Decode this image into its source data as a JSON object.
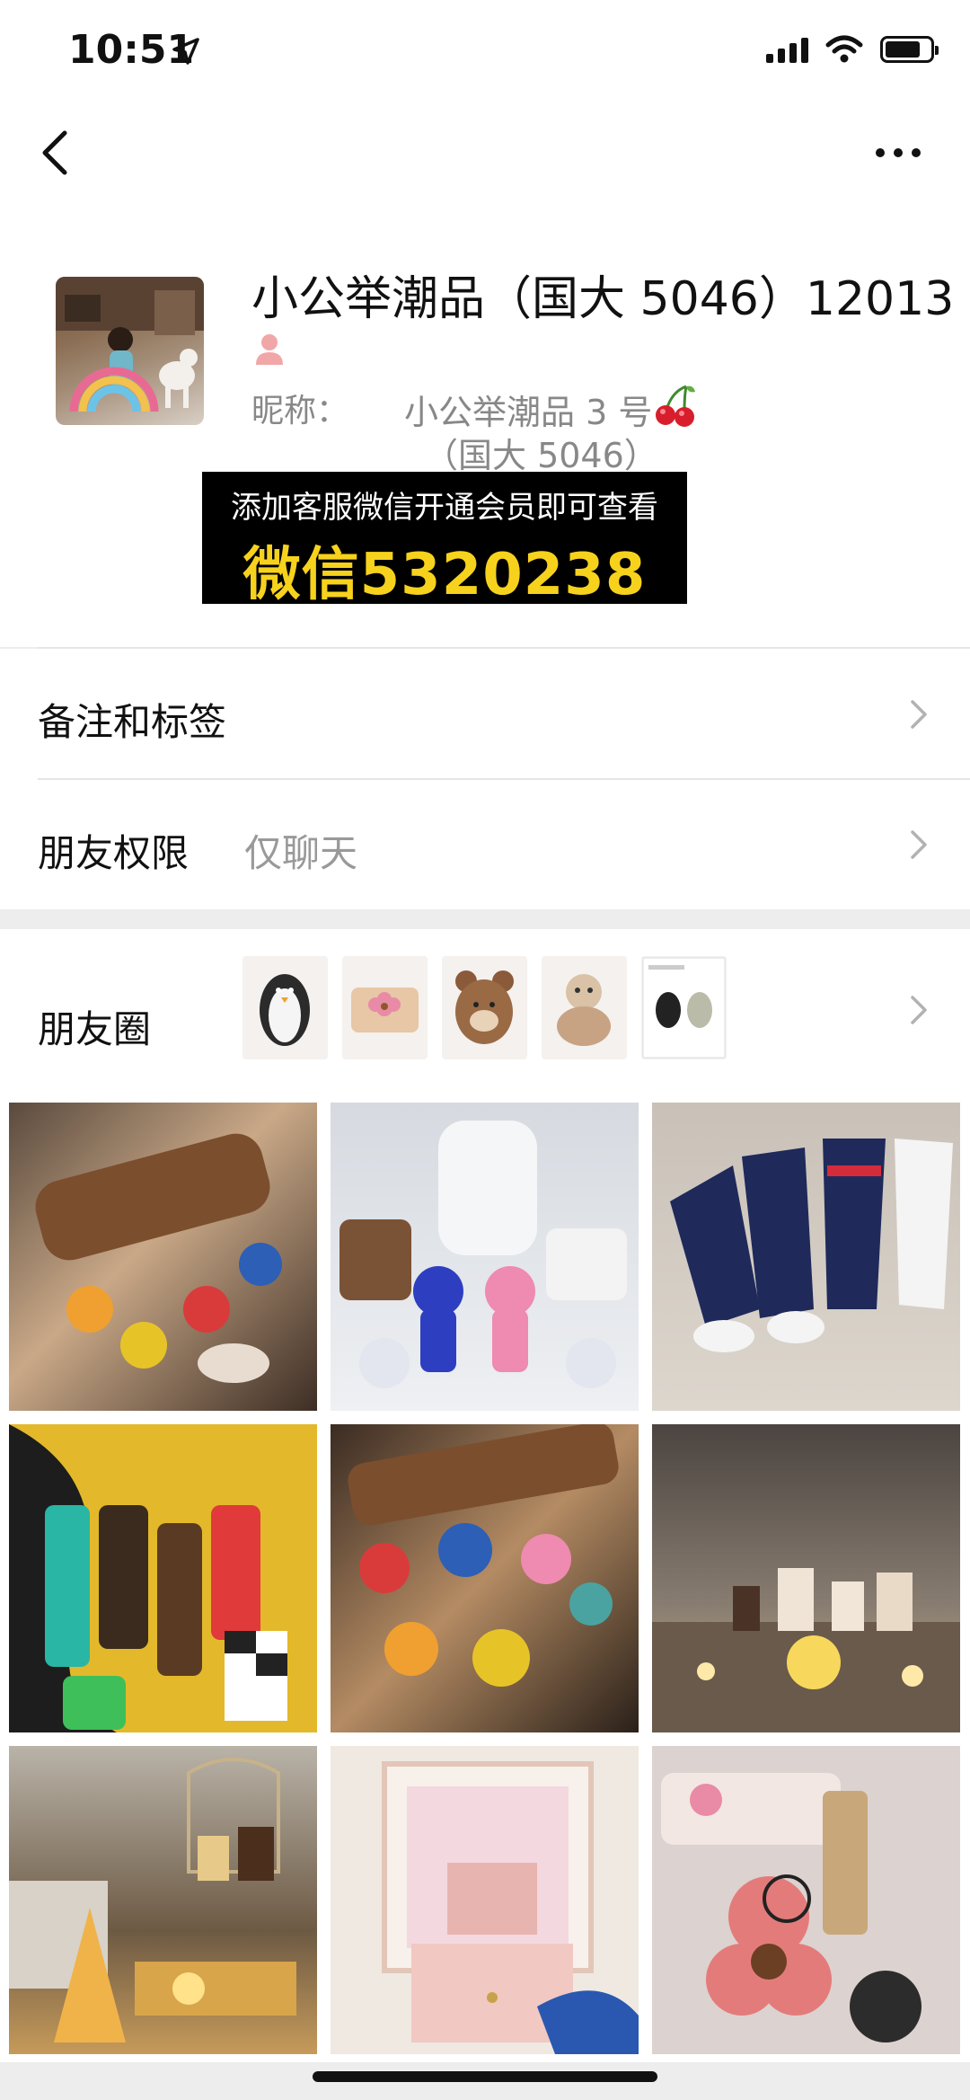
{
  "status_bar": {
    "time": "10:51"
  },
  "profile": {
    "name": "小公举潮品（国大 5046）12013",
    "nickname_label": "昵称：",
    "nickname_value_line1": "小公举潮品 3 号",
    "nickname_value_line2": "（国大 5046）"
  },
  "promo": {
    "line1": "添加客服微信开通会员即可查看",
    "line2": "微信5320238",
    "text_color": "#ffffff",
    "accent_color": "#f7d21d"
  },
  "rows": {
    "remarks_label": "备注和标签",
    "permissions_label": "朋友权限",
    "permissions_value": "仅聊天",
    "moments_label": "朋友圈"
  },
  "moments_thumbnails": [
    {
      "icon": "penguin-figure"
    },
    {
      "icon": "flower-coaster"
    },
    {
      "icon": "bear-bag"
    },
    {
      "icon": "plush-toy"
    },
    {
      "icon": "product-sheet"
    }
  ],
  "photo_grid": [
    {
      "subject": "bag-charms-tray"
    },
    {
      "subject": "bearbrick-figures"
    },
    {
      "subject": "striped-socks"
    },
    {
      "subject": "colorful-socks"
    },
    {
      "subject": "flower-keychains"
    },
    {
      "subject": "candles-shelf"
    },
    {
      "subject": "perfume-display"
    },
    {
      "subject": "pink-jewelry-box"
    },
    {
      "subject": "flower-tray-glasses"
    }
  ],
  "colors": {
    "background": "#ededed",
    "card": "#ffffff",
    "muted_text": "#888888"
  }
}
